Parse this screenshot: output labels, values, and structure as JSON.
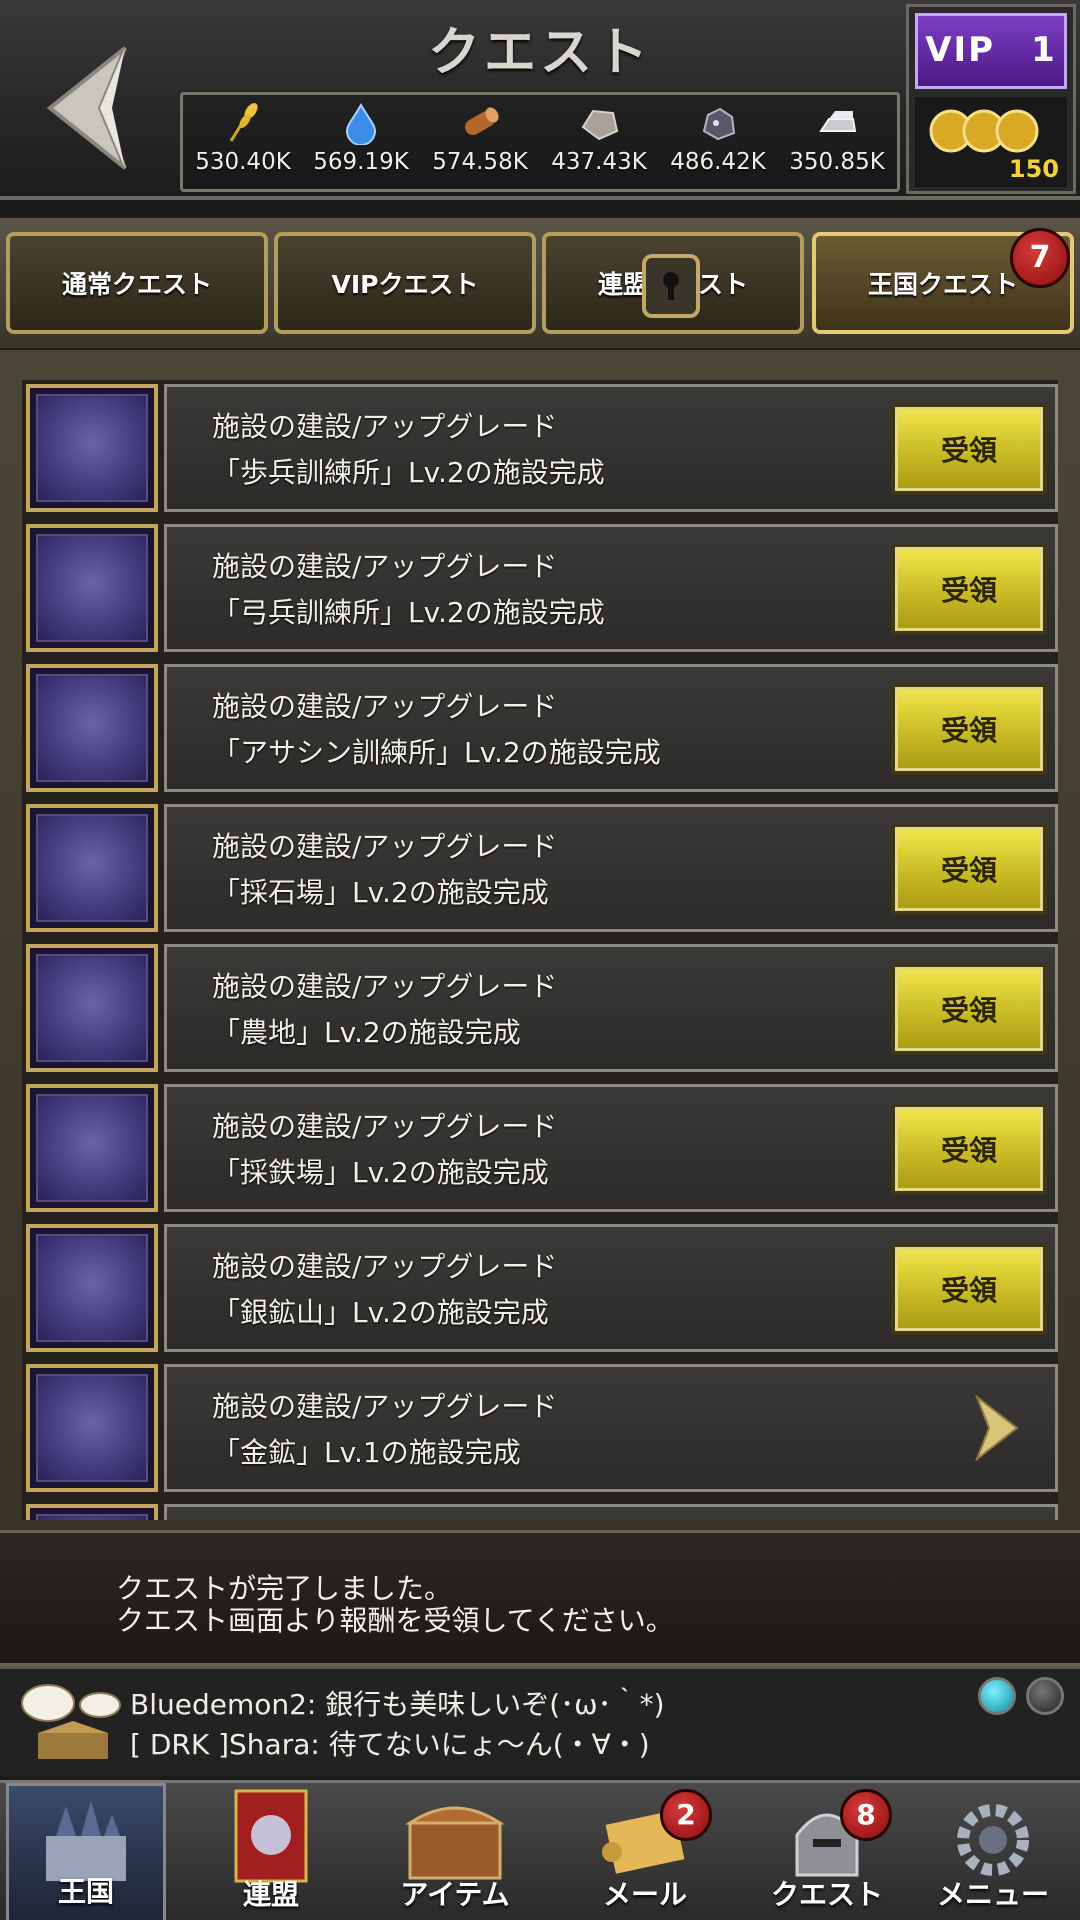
{
  "header": {
    "title": "クエスト",
    "resources": [
      {
        "name": "food",
        "icon": "wheat-icon",
        "value": "530.40K"
      },
      {
        "name": "water",
        "icon": "water-drop-icon",
        "value": "569.19K"
      },
      {
        "name": "wood",
        "icon": "log-icon",
        "value": "574.58K"
      },
      {
        "name": "stone",
        "icon": "stone-icon",
        "value": "437.43K"
      },
      {
        "name": "iron",
        "icon": "ore-icon",
        "value": "486.42K"
      },
      {
        "name": "silver",
        "icon": "silver-ingot-icon",
        "value": "350.85K"
      }
    ],
    "vip_label": "VIP　1",
    "coin_count": "150"
  },
  "tabs": [
    {
      "label": "通常クエスト",
      "active": false
    },
    {
      "label": "VIPクエスト",
      "active": false
    },
    {
      "label": "連盟クエスト",
      "active": false,
      "locked": true
    },
    {
      "label": "王国クエスト",
      "active": true,
      "badge": "7"
    }
  ],
  "quests": [
    {
      "title": "施設の建設/アップグレード",
      "desc": "「歩兵訓練所」Lv.2の施設完成",
      "action": "受領",
      "icon": "infantry-camp-icon"
    },
    {
      "title": "施設の建設/アップグレード",
      "desc": "「弓兵訓練所」Lv.2の施設完成",
      "action": "受領",
      "icon": "archer-camp-icon"
    },
    {
      "title": "施設の建設/アップグレード",
      "desc": "「アサシン訓練所」Lv.2の施設完成",
      "action": "受領",
      "icon": "assassin-camp-icon"
    },
    {
      "title": "施設の建設/アップグレード",
      "desc": "「採石場」Lv.2の施設完成",
      "action": "受領",
      "icon": "quarry-icon"
    },
    {
      "title": "施設の建設/アップグレード",
      "desc": "「農地」Lv.2の施設完成",
      "action": "受領",
      "icon": "farm-icon"
    },
    {
      "title": "施設の建設/アップグレード",
      "desc": "「採鉄場」Lv.2の施設完成",
      "action": "受領",
      "icon": "iron-mine-icon"
    },
    {
      "title": "施設の建設/アップグレード",
      "desc": "「銀鉱山」Lv.2の施設完成",
      "action": "受領",
      "icon": "silver-mine-icon"
    },
    {
      "title": "施設の建設/アップグレード",
      "desc": "「金鉱」Lv.1の施設完成",
      "action": "arrow",
      "icon": "gold-mine-icon"
    }
  ],
  "message": {
    "line1": "クエストが完了しました。",
    "line2": "クエスト画面より報酬を受領してください。"
  },
  "chat": {
    "line1": "Bluedemon2: 銀行も美味しいぞ(･ω･｀*)",
    "line2": "[ DRK ]Shara: 待てないにょ～ん(・∀・)"
  },
  "nav": [
    {
      "label": "王国",
      "icon": "castle-icon"
    },
    {
      "label": "連盟",
      "icon": "alliance-banner-icon"
    },
    {
      "label": "アイテム",
      "icon": "treasure-chest-icon"
    },
    {
      "label": "メール",
      "icon": "scroll-icon",
      "badge": "2"
    },
    {
      "label": "クエスト",
      "icon": "helmet-icon",
      "badge": "8"
    },
    {
      "label": "メニュー",
      "icon": "gear-icon"
    }
  ],
  "colors": {
    "gold": "#d4c52e",
    "badge_red": "#b21717",
    "vip_purple": "#6a2db0"
  }
}
